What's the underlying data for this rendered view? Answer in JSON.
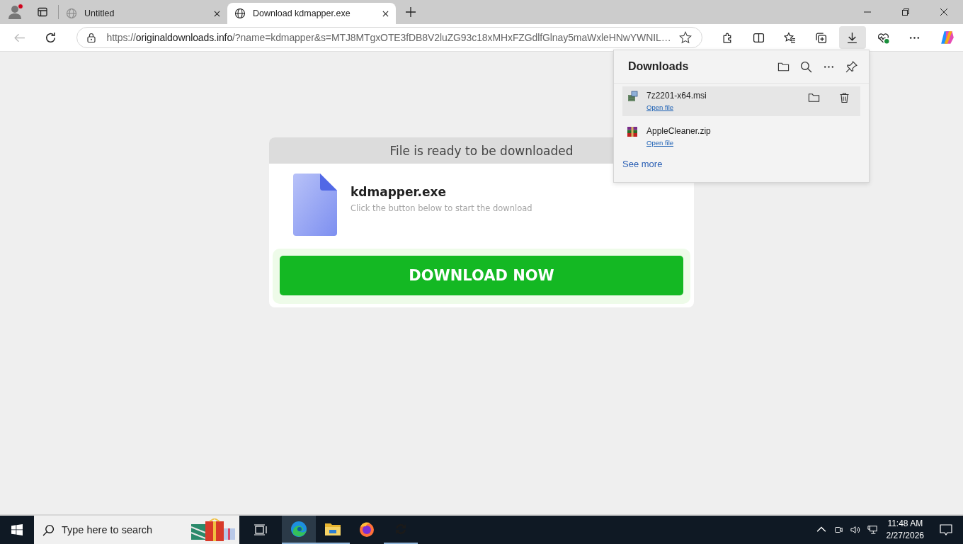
{
  "tabs": [
    {
      "title": "Untitled",
      "selected": false
    },
    {
      "title": "Download kdmapper.exe",
      "selected": true
    }
  ],
  "address_bar": {
    "scheme": "https://",
    "host": "originaldownloads.info",
    "rest": "/?name=kdmapper&s=MTJ8MTgxOTE3fDB8V2luZG93c18xMHxFZGdlfGlnay5maWxleHNwYWNIL…"
  },
  "downloads_panel": {
    "title": "Downloads",
    "items": [
      {
        "name": "7z2201-x64.msi",
        "kind": "installer",
        "action": "Open file",
        "selected": true
      },
      {
        "name": "AppleCleaner.zip",
        "kind": "archive",
        "action": "Open file",
        "selected": false
      }
    ],
    "see_more": "See more"
  },
  "page": {
    "header": "File is ready to be downloaded",
    "file_name": "kdmapper.exe",
    "hint": "Click the button below to start the download",
    "button": "DOWNLOAD NOW"
  },
  "taskbar": {
    "search_placeholder": "Type here to search",
    "apps": [
      {
        "kind": "edge",
        "active": true,
        "running": true
      },
      {
        "kind": "explorer",
        "active": false,
        "running": true
      },
      {
        "kind": "firefox",
        "active": false,
        "running": false
      },
      {
        "kind": "sync",
        "active": false,
        "running": true
      }
    ],
    "time": "11:48 AM",
    "date": "2/27/2026"
  }
}
